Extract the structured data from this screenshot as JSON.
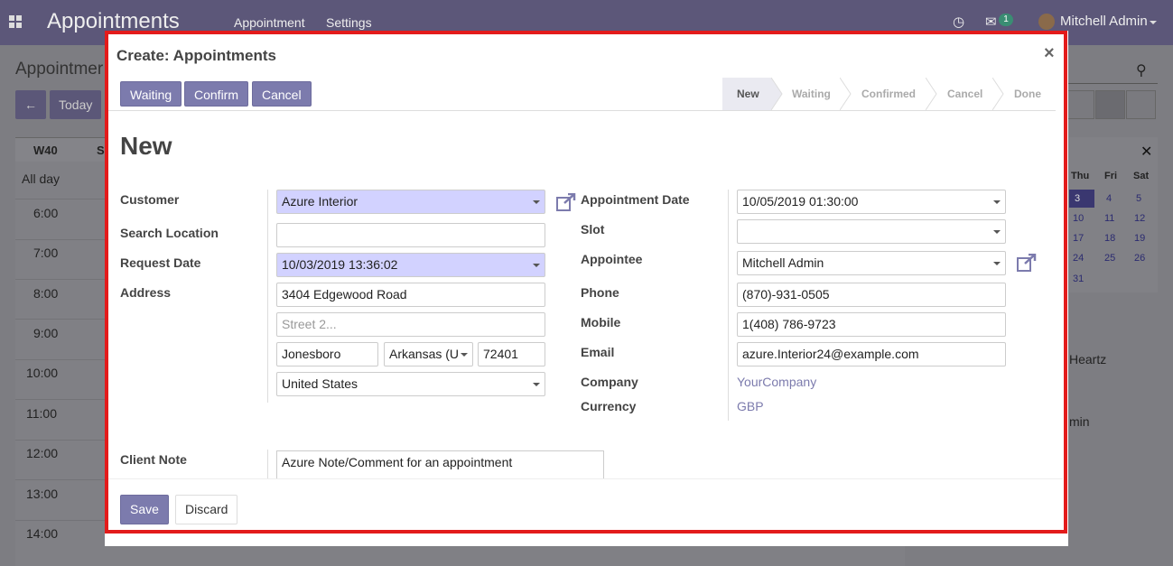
{
  "topbar": {
    "app_title": "Appointments",
    "menu_appointment": "Appointment",
    "menu_settings": "Settings",
    "chat_count": "1",
    "user_name": "Mitchell Admin"
  },
  "background": {
    "page_title": "Appointmer",
    "back_label": "←",
    "today_label": "Today",
    "week_label": "W40",
    "day_label": "S",
    "allday_label": "All day",
    "times": [
      "6:00",
      "7:00",
      "8:00",
      "9:00",
      "10:00",
      "11:00",
      "12:00",
      "13:00",
      "14:00"
    ],
    "mini_headers": [
      "Thu",
      "Fri",
      "Sat"
    ],
    "mini_rows": [
      [
        "3",
        "4",
        "5"
      ],
      [
        "10",
        "11",
        "12"
      ],
      [
        "17",
        "18",
        "19"
      ],
      [
        "24",
        "25",
        "26"
      ],
      [
        "31",
        "",
        ""
      ]
    ],
    "side_text_1": "Heartz",
    "side_text_2": "min"
  },
  "dialog": {
    "title": "Create: Appointments",
    "close_label": "×",
    "actions": {
      "waiting": "Waiting",
      "confirm": "Confirm",
      "cancel": "Cancel"
    },
    "stages": [
      "New",
      "Waiting",
      "Confirmed",
      "Cancel",
      "Done"
    ],
    "active_stage": "New",
    "record_name": "New",
    "left_labels": {
      "customer": "Customer",
      "search_location": "Search Location",
      "request_date": "Request Date",
      "address": "Address"
    },
    "left_values": {
      "customer": "Azure Interior",
      "search_location": "",
      "request_date": "10/03/2019 13:36:02",
      "street": "3404  Edgewood Road",
      "street2_placeholder": "Street 2...",
      "city": "Jonesboro",
      "state": "Arkansas (U",
      "zip": "72401",
      "country": "United States"
    },
    "right_labels": {
      "appointment_date": "Appointment Date",
      "slot": "Slot",
      "appointee": "Appointee",
      "phone": "Phone",
      "mobile": "Mobile",
      "email": "Email",
      "company": "Company",
      "currency": "Currency"
    },
    "right_values": {
      "appointment_date": "10/05/2019 01:30:00",
      "slot": "",
      "appointee": "Mitchell Admin",
      "phone": "(870)-931-0505",
      "mobile": "1(408) 786-9723",
      "email": "azure.Interior24@example.com",
      "company": "YourCompany",
      "currency": "GBP"
    },
    "client_note_label": "Client Note",
    "client_note_value": "Azure Note/Comment for an appointment",
    "footer": {
      "save": "Save",
      "discard": "Discard"
    }
  },
  "colors": {
    "brand": "#7c7bad",
    "required_field": "#d2d2ff",
    "highlight_border": "#e31b1b"
  }
}
